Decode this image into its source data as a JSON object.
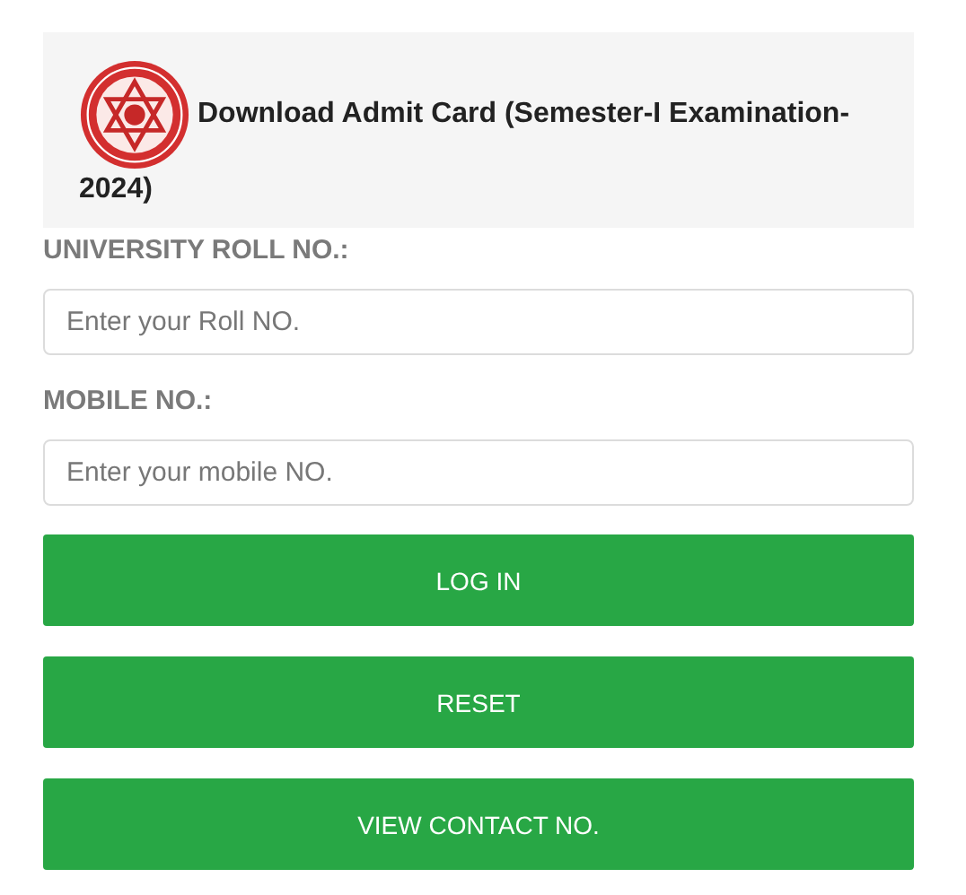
{
  "header": {
    "title": "Download Admit Card (Semester-I Examination-2024)"
  },
  "fields": [
    {
      "label": "UNIVERSITY ROLL NO.:",
      "placeholder": "Enter your Roll NO."
    },
    {
      "label": "MOBILE NO.:",
      "placeholder": "Enter your mobile NO."
    }
  ],
  "buttons": [
    "LOG IN",
    "RESET",
    "VIEW CONTACT NO."
  ]
}
